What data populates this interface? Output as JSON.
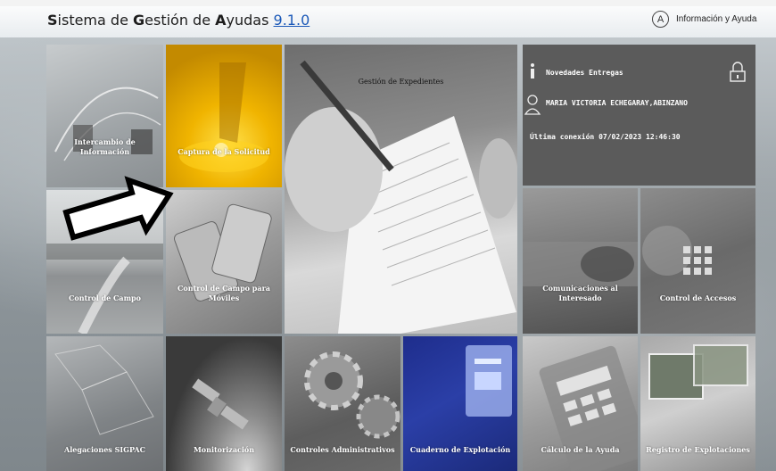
{
  "header": {
    "title_parts": [
      {
        "bold": "S",
        "rest": "istema de "
      },
      {
        "bold": "G",
        "rest": "estión de "
      },
      {
        "bold": "A",
        "rest": "yudas "
      }
    ],
    "version": "9.1.0",
    "help_icon_letter": "A",
    "help_label": "Información y Ayuda"
  },
  "tiles": {
    "intercambio": "Intercambio de Información",
    "captura": "Captura de la Solicitud",
    "gestion": "Gestión de Expedientes",
    "control_campo": "Control de Campo",
    "control_moviles": "Control de Campo para Móviles",
    "comunicaciones": "Comunicaciones al Interesado",
    "accesos": "Control de Accesos",
    "alegaciones": "Alegaciones SIGPAC",
    "monitorizacion": "Monitorización",
    "controles_admin": "Controles Administrativos",
    "cuaderno": "Cuaderno de Explotación",
    "calculo": "Cálculo de la Ayuda",
    "registro": "Registro de Explotaciones"
  },
  "novedades": {
    "title": "Novedades Entregas",
    "user": "MARIA VICTORIA ECHEGARAY,ABINZANO",
    "last_login": "Última conexión 07/02/2023 12:46:30"
  },
  "colors": {
    "accent_version": "#1b59b8",
    "captura_tile": "#f0b400",
    "cuaderno_tile": "#2b3fa7",
    "novedades_panel": "#5b5b5b"
  }
}
